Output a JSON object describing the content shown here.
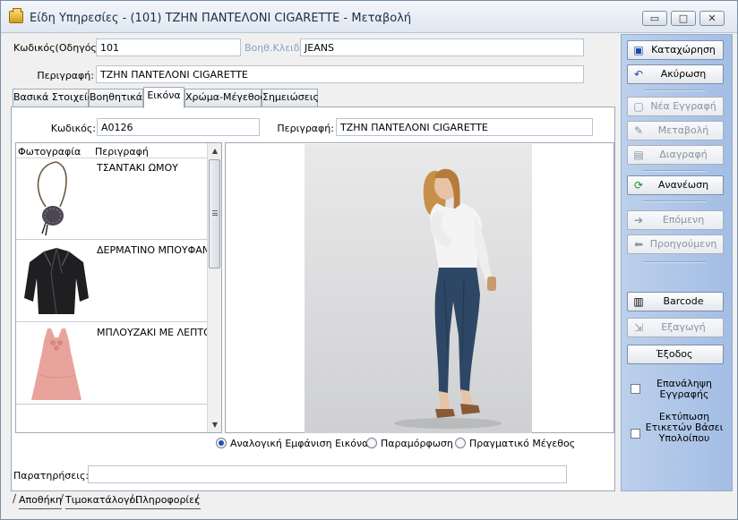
{
  "window": {
    "title": "Είδη Υπηρεσίες - (101) ΤΖΗΝ ΠΑΝΤΕΛΟΝΙ CIGARETTE  -  Μεταβολή",
    "min_glyph": "▭",
    "max_glyph": "□",
    "close_glyph": "✕"
  },
  "header": {
    "code_label": "Κωδικός(Οδηγός):",
    "code_value": "101",
    "aux_key_label": "Βοηθ.Κλειδί:",
    "aux_key_value": "JEANS",
    "desc_label": "Περιγραφή:",
    "desc_value": "ΤΖΗΝ ΠΑΝΤΕΛΟΝΙ CIGARETTE"
  },
  "tabs": [
    {
      "label": "Βασικά Στοιχεία"
    },
    {
      "label": "Βοηθητικά"
    },
    {
      "label": "Εικόνα"
    },
    {
      "label": "Χρώμα-Μέγεθος"
    },
    {
      "label": "Σημειώσεις"
    }
  ],
  "image_tab": {
    "code_label": "Κωδικός:",
    "code_value": "A0126",
    "desc_label": "Περιγραφή:",
    "desc_value": "ΤΖΗΝ ΠΑΝΤΕΛΟΝΙ CIGARETTE",
    "list_headers": {
      "photo": "Φωτογραφία",
      "desc": "Περιγραφή"
    },
    "rows": [
      {
        "desc": "ΤΣΑΝΤΑΚΙ ΩΜΟΥ"
      },
      {
        "desc": "ΔΕΡΜΑΤΙΝΟ ΜΠΟΥΦΑΝ"
      },
      {
        "desc": "ΜΠΛΟΥΖΑΚΙ ΜΕ ΛΕΠΤΟΜΙ"
      }
    ],
    "display_modes": [
      {
        "label": "Αναλογική Εμφάνιση Εικόνας",
        "selected": true
      },
      {
        "label": "Παραμόρφωση",
        "selected": false
      },
      {
        "label": "Πραγματικό Μέγεθος",
        "selected": false
      }
    ],
    "notes_label": "Παρατηρήσεις:",
    "notes_value": ""
  },
  "side_panel": {
    "save": "Καταχώρηση",
    "cancel": "Ακύρωση",
    "new_record": "Νέα Εγγραφή",
    "modify": "Μεταβολή",
    "delete": "Διαγραφή",
    "refresh": "Ανανέωση",
    "next": "Επόμενη",
    "previous": "Προηγούμενη",
    "barcode": "Barcode",
    "export": "Εξαγωγή",
    "exit": "Έξοδος",
    "repeat_record": "Επανάληψη Εγγραφής",
    "print_labels": "Εκτύπωση Ετικετών Βάσει Υπολοίπου"
  },
  "bottom_tabs": [
    {
      "label": "Αποθήκη"
    },
    {
      "label": "Τιμοκατάλογοι"
    },
    {
      "label": "Πληροφορίες"
    }
  ],
  "colors": {
    "side_panel": "#a9c1e6",
    "accent": "#1f4fb4"
  }
}
